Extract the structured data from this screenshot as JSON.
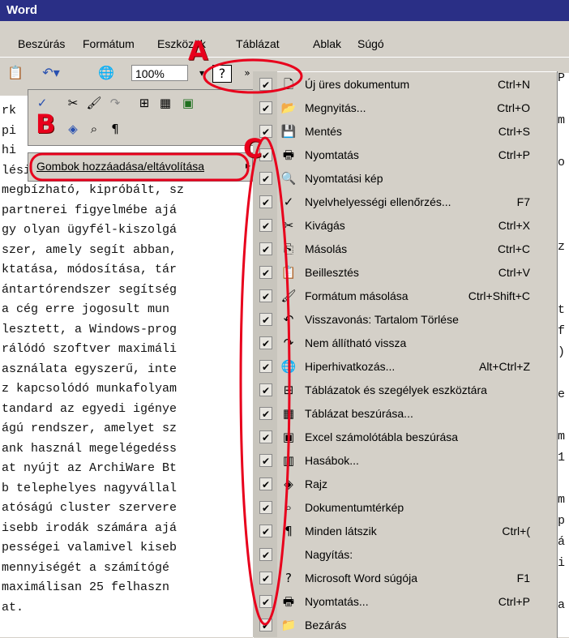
{
  "window": {
    "title": "Word"
  },
  "menubar": [
    "Beszúrás",
    "Formátum",
    "Eszközök",
    "Táblázat",
    "Ablak",
    "Súgó"
  ],
  "toolbar": {
    "zoom": "100%"
  },
  "annotations": {
    "a": "A",
    "b": "B",
    "c": "C"
  },
  "add_remove_label": "Gombok hozzáadása/eltávolítása",
  "document_lines": [
    "rk",
    "pi",
    "hi",
    "lési tapasztalatok bővü",
    "megbízható, kipróbált, sz",
    "partnerei figyelmébe ajá",
    "gy olyan ügyfél-kiszolgá",
    "szer, amely segít abban,",
    "ktatása, módosítása, tár",
    "ántartórendszer segítség",
    "a cég erre jogosult mun",
    "lesztett, a Windows-prog",
    "rálódó szoftver maximáli",
    "asználata egyszerű, inte",
    "z kapcsolódó munkafolyam",
    "tandard az egyedi igénye",
    "ágú rendszer, amelyet sz",
    "ank használ megelégedéss",
    "at nyújt az ArchiWare Bt",
    "b telephelyes nagyvállal",
    "atóságú cluster szervere",
    "isebb irodák számára ajá",
    "pességei valamivel kiseb",
    "mennyiségét a számítógé",
    "maximálisan 25 felhaszn",
    "at."
  ],
  "menu_items": [
    {
      "icon": "new-doc-icon",
      "label": "Új üres dokumentum",
      "shortcut": "Ctrl+N"
    },
    {
      "icon": "open-icon",
      "label": "Megnyitás...",
      "shortcut": "Ctrl+O"
    },
    {
      "icon": "save-icon",
      "label": "Mentés",
      "shortcut": "Ctrl+S"
    },
    {
      "icon": "print-icon",
      "label": "Nyomtatás",
      "shortcut": "Ctrl+P"
    },
    {
      "icon": "print-preview-icon",
      "label": "Nyomtatási kép",
      "shortcut": ""
    },
    {
      "icon": "spellcheck-icon",
      "label": "Nyelvhelyességi ellenőrzés...",
      "shortcut": "F7"
    },
    {
      "icon": "cut-icon",
      "label": "Kivágás",
      "shortcut": "Ctrl+X"
    },
    {
      "icon": "copy-icon",
      "label": "Másolás",
      "shortcut": "Ctrl+C"
    },
    {
      "icon": "paste-icon",
      "label": "Beillesztés",
      "shortcut": "Ctrl+V"
    },
    {
      "icon": "format-painter-icon",
      "label": "Formátum másolása",
      "shortcut": "Ctrl+Shift+C"
    },
    {
      "icon": "undo-icon",
      "label": "Visszavonás: Tartalom Törlése",
      "shortcut": ""
    },
    {
      "icon": "redo-icon",
      "label": "Nem állítható vissza",
      "shortcut": ""
    },
    {
      "icon": "hyperlink-icon",
      "label": "Hiperhivatkozás...",
      "shortcut": "Alt+Ctrl+Z"
    },
    {
      "icon": "tables-borders-icon",
      "label": "Táblázatok és szegélyek eszköztára",
      "shortcut": ""
    },
    {
      "icon": "insert-table-icon",
      "label": "Táblázat beszúrása...",
      "shortcut": ""
    },
    {
      "icon": "excel-icon",
      "label": "Excel számolótábla beszúrása",
      "shortcut": ""
    },
    {
      "icon": "columns-icon",
      "label": "Hasábok...",
      "shortcut": ""
    },
    {
      "icon": "drawing-icon",
      "label": "Rajz",
      "shortcut": ""
    },
    {
      "icon": "document-map-icon",
      "label": "Dokumentumtérkép",
      "shortcut": ""
    },
    {
      "icon": "pilcrow-icon",
      "label": "Minden látszik",
      "shortcut": "Ctrl+("
    },
    {
      "icon": "zoom-icon",
      "label": "Nagyítás:",
      "shortcut": ""
    },
    {
      "icon": "help-icon",
      "label": "Microsoft Word súgója",
      "shortcut": "F1"
    },
    {
      "icon": "print-icon",
      "label": "Nyomtatás...",
      "shortcut": "Ctrl+P"
    },
    {
      "icon": "close-folder-icon",
      "label": "Bezárás",
      "shortcut": ""
    }
  ],
  "right_edge_chars": [
    "P",
    "",
    "m",
    "",
    "o",
    "",
    "",
    "",
    "z",
    "",
    "",
    "t",
    "f",
    ")",
    "",
    "e",
    "",
    "m",
    "1",
    "",
    "m",
    "p",
    "á",
    "i",
    "",
    "a"
  ],
  "accent_red": "#e8001c"
}
